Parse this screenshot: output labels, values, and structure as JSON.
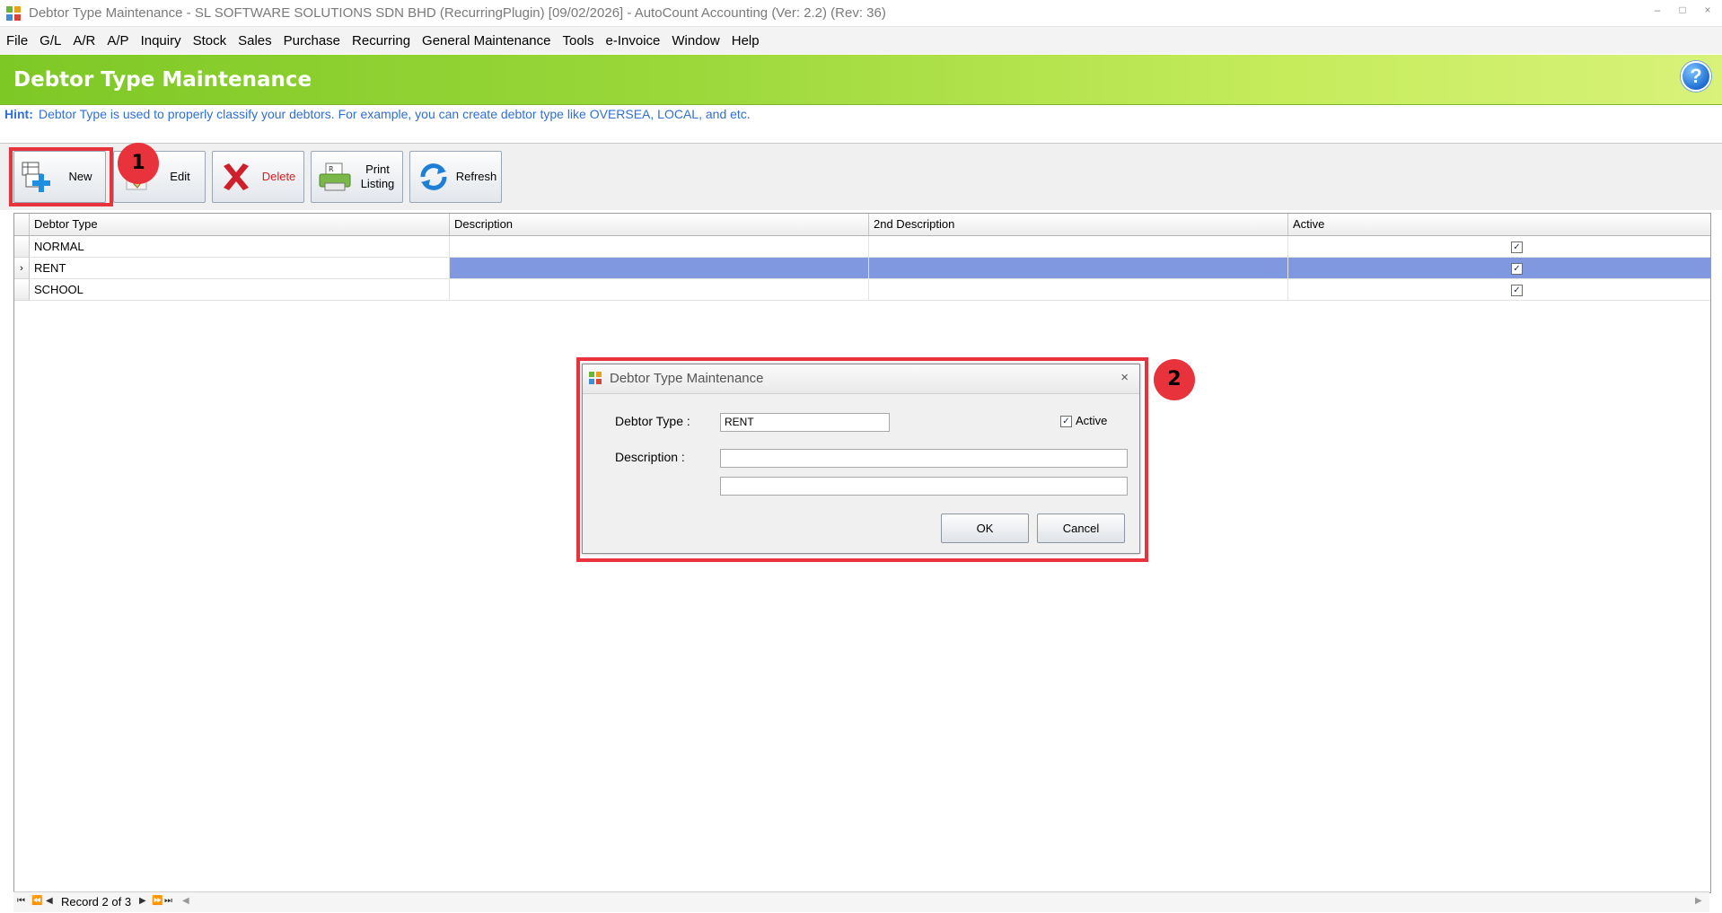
{
  "window": {
    "title": "Debtor Type Maintenance - SL SOFTWARE SOLUTIONS SDN BHD (RecurringPlugin) [09/02/2026] - AutoCount Accounting (Ver: 2.2) (Rev: 36)",
    "controls": [
      "–",
      "□",
      "×"
    ]
  },
  "menu": [
    "File",
    "G/L",
    "A/R",
    "A/P",
    "Inquiry",
    "Stock",
    "Sales",
    "Purchase",
    "Recurring",
    "General Maintenance",
    "Tools",
    "e-Invoice",
    "Window",
    "Help"
  ],
  "header": {
    "title": "Debtor Type Maintenance",
    "help": "?"
  },
  "hint": {
    "label": "Hint:",
    "text": "Debtor Type is used to properly classify your debtors. For example, you can create debtor type like OVERSEA, LOCAL, and etc."
  },
  "toolbar": {
    "new": "New",
    "edit": "Edit",
    "delete": "Delete",
    "print_line1": "Print",
    "print_line2": "Listing",
    "refresh": "Refresh"
  },
  "annotations": {
    "badge1": "1",
    "badge2": "2",
    "color": "#e8323c"
  },
  "grid": {
    "columns": [
      "Debtor Type",
      "Description",
      "2nd Description",
      "Active"
    ],
    "rows": [
      {
        "type": "NORMAL",
        "description": "",
        "description2": "",
        "active": true
      },
      {
        "type": "RENT",
        "description": "",
        "description2": "",
        "active": true,
        "selected": true
      },
      {
        "type": "SCHOOL",
        "description": "",
        "description2": "",
        "active": true
      }
    ],
    "selection_color": "#7f98df"
  },
  "navigator": {
    "record": "Record 2 of 3"
  },
  "dialog": {
    "title": "Debtor Type Maintenance",
    "close": "×",
    "debtor_type_label": "Debtor Type :",
    "debtor_type_value": "RENT",
    "description_label": "Description :",
    "description_value": "",
    "description2_value": "",
    "active_label": "Active",
    "active": true,
    "ok": "OK",
    "cancel": "Cancel"
  }
}
